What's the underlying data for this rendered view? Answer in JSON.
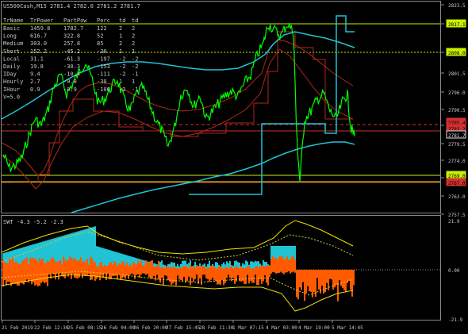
{
  "header": {
    "symbol_line": "US500Cash,M15  2781.4 2782.0 2781.2 2781.7"
  },
  "stats_table": {
    "columns": [
      "TrName",
      "TrPower",
      "PartPow",
      "Perc",
      "td",
      "td"
    ],
    "rows": [
      [
        "Basic",
        "1459.8",
        "1782.7",
        "122",
        "2",
        "2"
      ],
      [
        "Long",
        "616.7",
        "322.8",
        "52",
        "1",
        "2"
      ],
      [
        "Medium",
        "303.0",
        "257.8",
        "85",
        "2",
        "2"
      ],
      [
        "Short",
        "152.2",
        "-45.2",
        "-30",
        "1",
        "1"
      ],
      [
        "Local",
        "31.1",
        "-61.3",
        "-197",
        "-2",
        "-2"
      ],
      [
        "Daily",
        "19.8",
        "-30.3",
        "-153",
        "-2",
        "-2"
      ],
      [
        "IDay",
        "9.4",
        "-10.4",
        "-111",
        "-2",
        "-1"
      ],
      [
        "Hourly",
        "2.7",
        "-0.8",
        "-30",
        "1",
        "1"
      ],
      [
        "IHour",
        "0.9",
        "-0.9",
        "-100",
        "-2",
        "-1"
      ]
    ],
    "footer": "V=5.0"
  },
  "price_axis": {
    "ticks": [
      "2823.5",
      "2812.5",
      "2806.0",
      "2801.5",
      "2796.0",
      "2790.5",
      "2785.0",
      "2779.5",
      "2774.0",
      "2768.5",
      "2763.0",
      "2757.5"
    ],
    "level_labels": [
      {
        "text": "2817.1",
        "color": "#c8f000"
      },
      {
        "text": "2808.0",
        "color": "#c8f000"
      },
      {
        "text": "2785.4",
        "color": "#d03030"
      },
      {
        "text": "2783.2",
        "color": "#d03030"
      },
      {
        "text": "2781.7",
        "color": "#e0e0e0"
      },
      {
        "text": "2769.0",
        "color": "#c8f000"
      },
      {
        "text": "2767.0",
        "color": "#d03030"
      }
    ]
  },
  "indicator": {
    "label": "SWT -4.3 -5.2 -2.3",
    "ticks": [
      "21.9",
      "0.00",
      "-21.9"
    ]
  },
  "time_axis": {
    "labels": [
      "21 Feb 2019",
      "22 Feb 12:30",
      "25 Feb 08:15",
      "26 Feb 04:00",
      "26 Feb 20:00",
      "27 Feb 15:45",
      "28 Feb 11:30",
      "1 Mar 07:15",
      "4 Mar 03:00",
      "4 Mar 19:00",
      "5 Mar 14:45"
    ]
  },
  "colors": {
    "background": "#000000",
    "price_line": "#00ff00",
    "cyan": "#1fc3d3",
    "red_band": "#b02818",
    "yellow_level": "#c8f000",
    "orange_fill": "#ff5a00",
    "cyan_fill": "#1fc3d3",
    "grey_fill": "#8a8a8a"
  }
}
